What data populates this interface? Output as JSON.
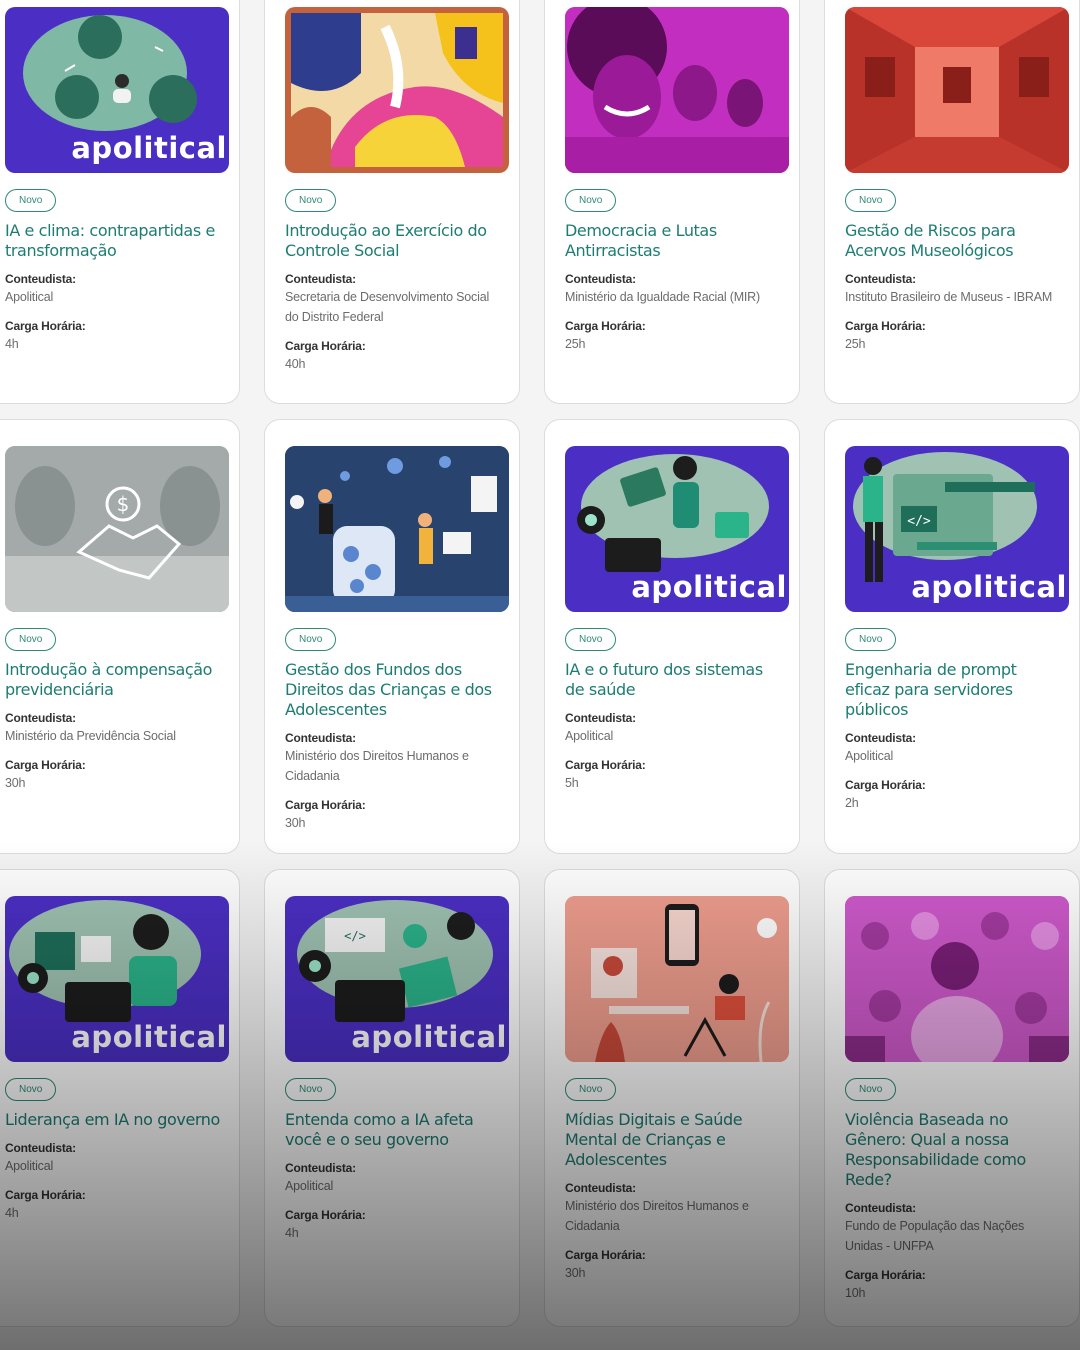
{
  "brand_text": "apolitical",
  "badge_text": "Novo",
  "author_label": "Conteudista:",
  "hours_label": "Carga Horária:",
  "courses": [
    {
      "title": "IA e clima: contrapartidas e transformação",
      "author": "Apolitical",
      "hours": "4h",
      "image": "apolitical-illustration"
    },
    {
      "title": "Introdução ao Exercício do Controle Social",
      "author": "Secretaria de Desenvolvimento Social do Distrito Federal",
      "hours": "40h",
      "image": "abstract-art"
    },
    {
      "title": "Democracia e Lutas Antirracistas",
      "author": "Ministério da Igualdade Racial (MIR)",
      "hours": "25h",
      "image": "people-photo"
    },
    {
      "title": "Gestão de Riscos para Acervos Museológicos",
      "author": "Instituto Brasileiro de Museus - IBRAM",
      "hours": "25h",
      "image": "museum-photo"
    },
    {
      "title": "Introdução à compensação previdenciária",
      "author": "Ministério da Previdência Social",
      "hours": "30h",
      "image": "handshake-photo"
    },
    {
      "title": "Gestão dos Fundos dos Direitos das Crianças e dos Adolescentes",
      "author": "Ministério dos Direitos Humanos e Cidadania",
      "hours": "30h",
      "image": "fund-illustration"
    },
    {
      "title": "IA e o futuro dos sistemas de saúde",
      "author": "Apolitical",
      "hours": "5h",
      "image": "apolitical-illustration"
    },
    {
      "title": "Engenharia de prompt eficaz para servidores públicos",
      "author": "Apolitical",
      "hours": "2h",
      "image": "apolitical-illustration"
    },
    {
      "title": "Liderança em IA no governo",
      "author": "Apolitical",
      "hours": "4h",
      "image": "apolitical-illustration"
    },
    {
      "title": "Entenda como a IA afeta você e o seu governo",
      "author": "Apolitical",
      "hours": "4h",
      "image": "apolitical-illustration"
    },
    {
      "title": "Mídias Digitais e Saúde Mental de Crianças e Adolescentes",
      "author": "Ministério dos Direitos Humanos e Cidadania",
      "hours": "30h",
      "image": "digital-media-illustration"
    },
    {
      "title": "Violência Baseada no Gênero: Qual a nossa Responsabilidade como Rede?",
      "author": "Fundo de População das Nações Unidas - UNFPA",
      "hours": "10h",
      "image": "gender-illustration"
    }
  ],
  "colors": {
    "accent": "#1d7d73",
    "badge": "#2f8a78",
    "apolitical_purple": "#4b2fc4",
    "magenta": "#c22fc0",
    "museum_red": "#e0473a",
    "fund_navy": "#27436e",
    "salmon": "#ef9e8e"
  }
}
